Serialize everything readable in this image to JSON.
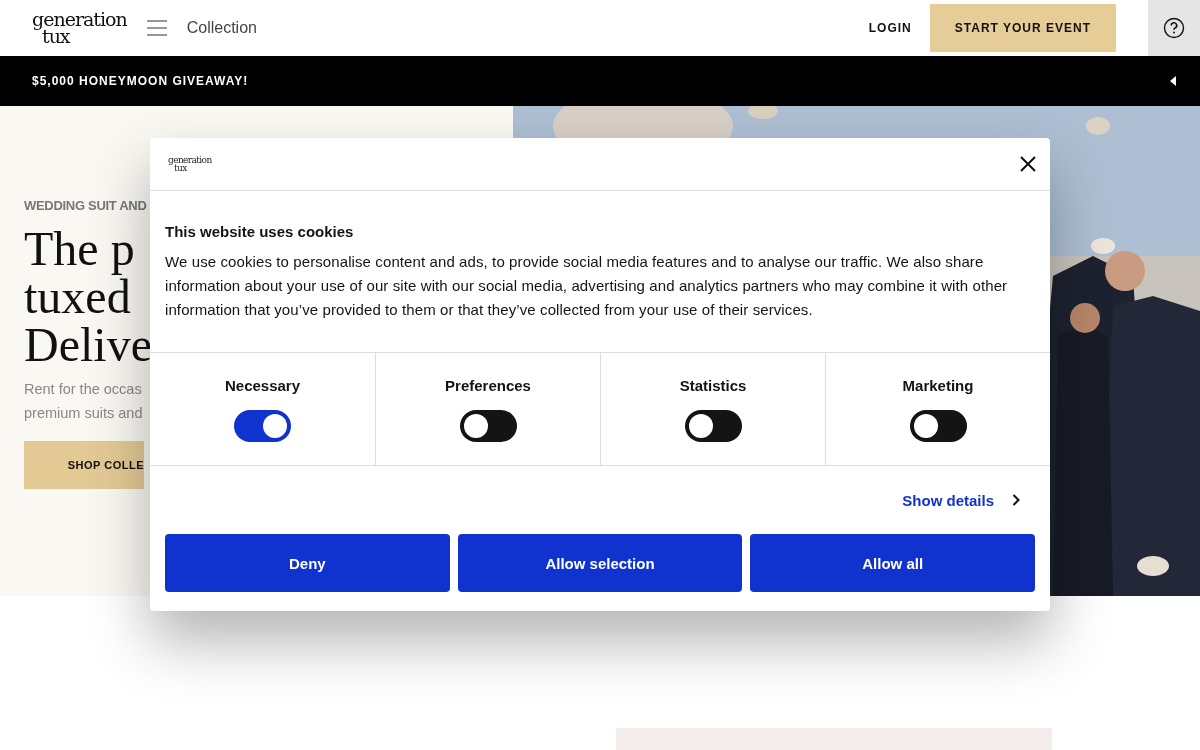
{
  "header": {
    "logo": [
      "generation",
      "tux"
    ],
    "nav_link": "Collection",
    "login": "LOGIN",
    "cta": "START YOUR EVENT"
  },
  "promo_bar": {
    "text": "$5,000 HONEYMOON GIVEAWAY!"
  },
  "hero": {
    "eyebrow": "WEDDING SUIT AND",
    "title_lines": [
      "The p",
      "tuxed",
      "Delive"
    ],
    "subtitle_lines": [
      "Rent for the occas",
      "premium suits and"
    ],
    "button": "SHOP COLLE",
    "photo": {
      "kind": "picture"
    }
  },
  "cookie_dialog": {
    "logo": [
      "generation",
      "tux"
    ],
    "title": "This website uses cookies",
    "body": "We use cookies to personalise content and ads, to provide social media features and to analyse our traffic. We also share information about your use of our site with our social media, advertising and analytics partners who may combine it with other information that you’ve provided to them or that they’ve collected from your use of their services.",
    "toggles": [
      {
        "label": "Necessary",
        "on": true
      },
      {
        "label": "Preferences",
        "on": false
      },
      {
        "label": "Statistics",
        "on": false
      },
      {
        "label": "Marketing",
        "on": false
      }
    ],
    "details_link": "Show details",
    "buttons": [
      "Deny",
      "Allow selection",
      "Allow all"
    ]
  }
}
